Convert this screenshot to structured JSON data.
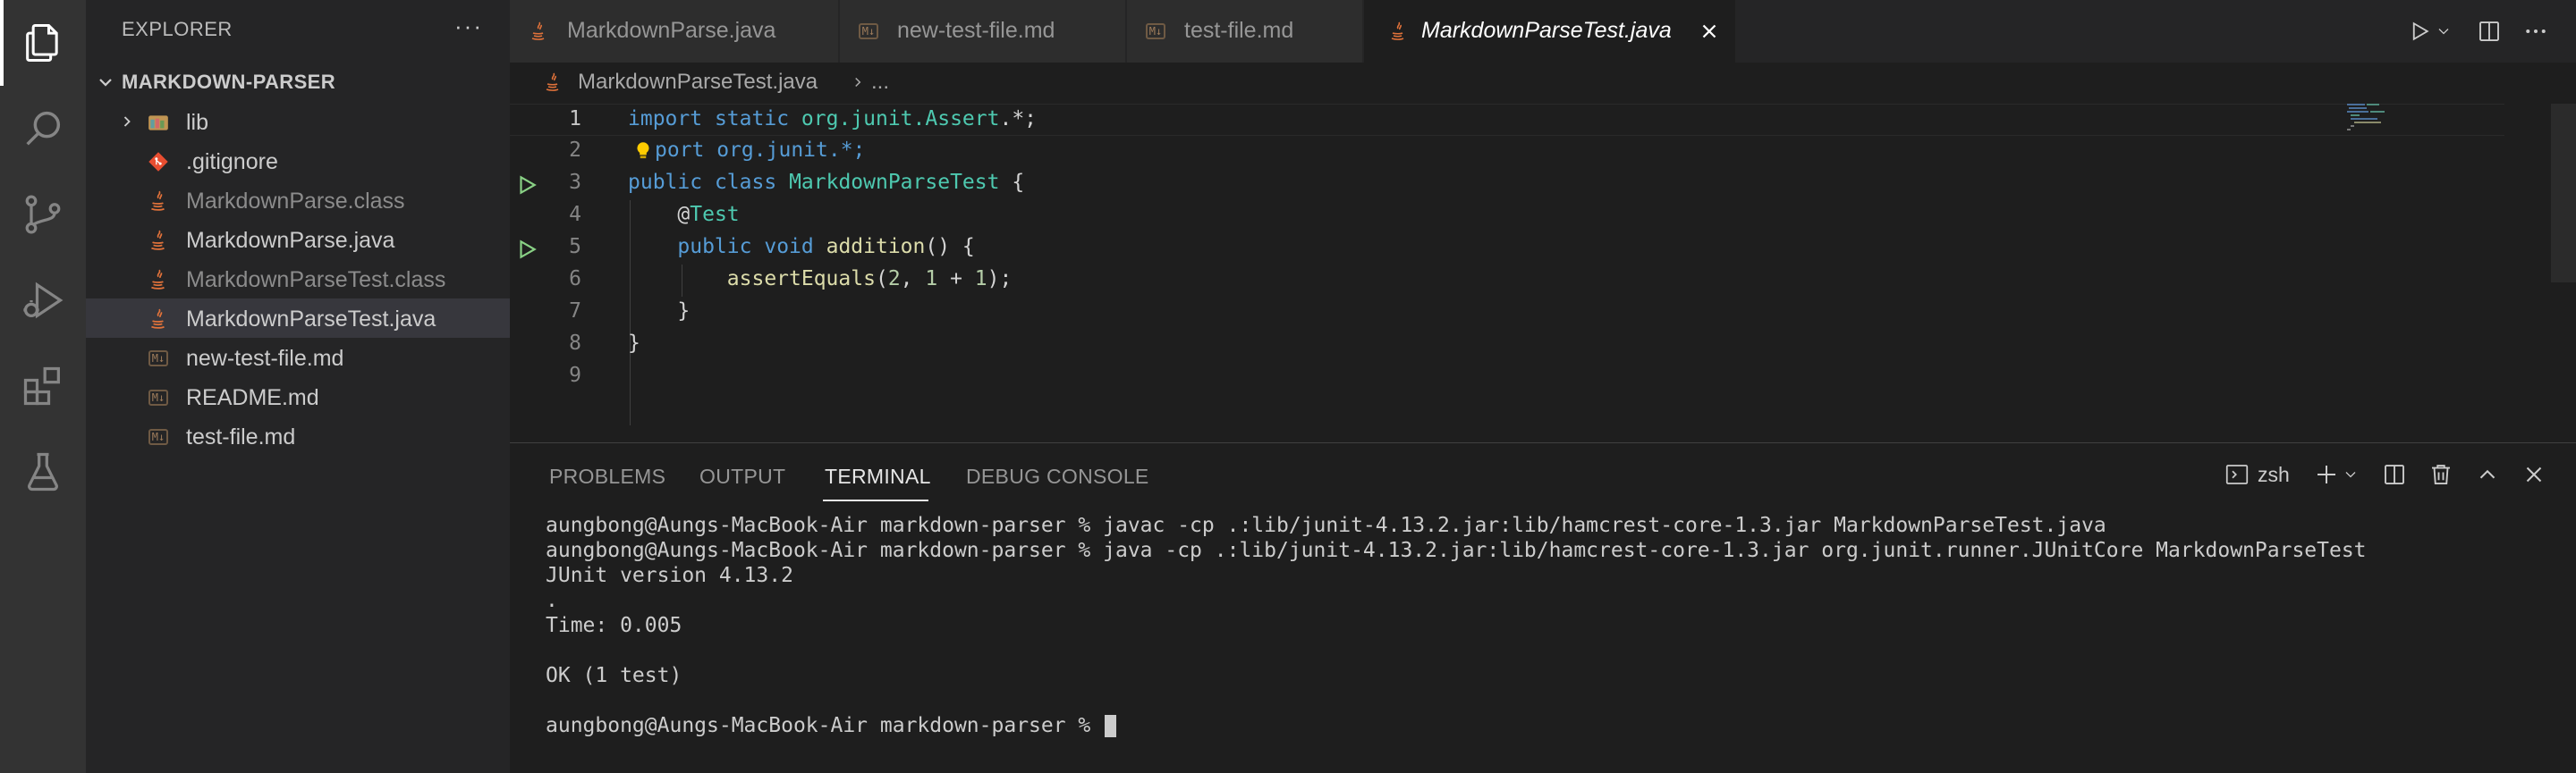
{
  "activity_bar": {
    "items": [
      "explorer-icon",
      "search-icon",
      "source-control-icon",
      "run-debug-icon",
      "extensions-icon",
      "testing-icon"
    ],
    "active": "explorer-icon"
  },
  "sidebar": {
    "title": "EXPLORER",
    "more": "···",
    "section": "MARKDOWN-PARSER",
    "items": [
      {
        "label": "lib",
        "kind": "folder"
      },
      {
        "label": ".gitignore",
        "kind": "git"
      },
      {
        "label": "MarkdownParse.class",
        "kind": "java",
        "dim": true
      },
      {
        "label": "MarkdownParse.java",
        "kind": "java"
      },
      {
        "label": "MarkdownParseTest.class",
        "kind": "java",
        "dim": true
      },
      {
        "label": "MarkdownParseTest.java",
        "kind": "java",
        "selected": true
      },
      {
        "label": "new-test-file.md",
        "kind": "md"
      },
      {
        "label": "README.md",
        "kind": "md"
      },
      {
        "label": "test-file.md",
        "kind": "md"
      }
    ]
  },
  "tabs": [
    {
      "label": "MarkdownParse.java",
      "kind": "java"
    },
    {
      "label": "new-test-file.md",
      "kind": "md"
    },
    {
      "label": "test-file.md",
      "kind": "md"
    },
    {
      "label": "MarkdownParseTest.java",
      "kind": "java",
      "active": true
    }
  ],
  "md_icon_text": "M↓",
  "breadcrumb": {
    "file": "MarkdownParseTest.java",
    "rest": "..."
  },
  "editor": {
    "line_numbers": [
      "1",
      "2",
      "3",
      "4",
      "5",
      "6",
      "7",
      "8",
      "9"
    ],
    "current_line": 1,
    "lines": {
      "l1": {
        "kw1": "import",
        "kw2": "static",
        "pkg": "org.junit.",
        "cls": "Assert",
        "rest": ".*;"
      },
      "l2": {
        "text": "port org.junit.*;"
      },
      "l3": {
        "kw1": "public",
        "kw2": "class",
        "cls": "MarkdownParseTest",
        "rest": " {"
      },
      "l4": {
        "at": "@",
        "ann": "Test"
      },
      "l5": {
        "kw1": "public",
        "kw2": "void",
        "fn": "addition",
        "rest": "() {"
      },
      "l6": {
        "fn": "assertEquals",
        "p1": "(",
        "n1": "2",
        "p2": ", ",
        "n2": "1",
        "p3": " + ",
        "n3": "1",
        "p4": ");"
      },
      "l7": {
        "text": "}"
      },
      "l8": {
        "text": "}"
      }
    }
  },
  "panel": {
    "tabs": [
      "PROBLEMS",
      "OUTPUT",
      "TERMINAL",
      "DEBUG CONSOLE"
    ],
    "active_tab": "TERMINAL",
    "shell": "zsh",
    "terminal_lines": [
      "aungbong@Aungs-MacBook-Air markdown-parser % javac -cp .:lib/junit-4.13.2.jar:lib/hamcrest-core-1.3.jar MarkdownParseTest.java",
      "aungbong@Aungs-MacBook-Air markdown-parser % java -cp .:lib/junit-4.13.2.jar:lib/hamcrest-core-1.3.jar org.junit.runner.JUnitCore MarkdownParseTest",
      "JUnit version 4.13.2",
      ".",
      "Time: 0.005",
      "",
      "OK (1 test)",
      "",
      "aungbong@Aungs-MacBook-Air markdown-parser % "
    ]
  },
  "colors": {
    "keyword": "#569cd6",
    "type": "#4ec9b0",
    "function": "#dcdcaa",
    "number": "#b5cea8",
    "java_icon": "#e1723a",
    "run_glyph": "#89d185"
  }
}
